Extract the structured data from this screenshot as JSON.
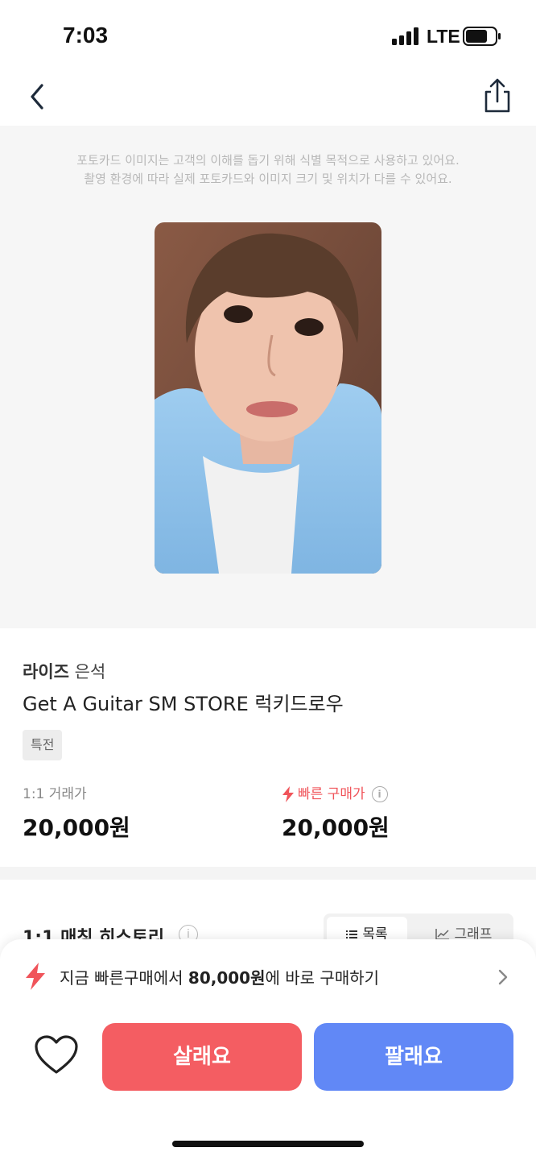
{
  "status_bar": {
    "time": "7:03",
    "network": "LTE"
  },
  "image_section": {
    "notice_line1": "포토카드 이미지는 고객의 이해를 돕기 위해 식별 목적으로 사용하고 있어요.",
    "notice_line2": "촬영 환경에 따라 실제 포토카드와 이미지 크기 및 위치가 다를 수 있어요."
  },
  "product": {
    "group": "라이즈",
    "member": "은석",
    "name": "Get A Guitar SM STORE 럭키드로우",
    "tag": "특전",
    "trade_price_label": "1:1 거래가",
    "trade_price": "20,000원",
    "fast_price_label": "빠른 구매가",
    "fast_price": "20,000원"
  },
  "history": {
    "title": "1:1 매칭 히스토리",
    "tabs": [
      {
        "label": "목록",
        "active": true
      },
      {
        "label": "그래프",
        "active": false
      }
    ]
  },
  "promo": {
    "prefix": "지금 빠른구매에서 ",
    "amount": "80,000원",
    "suffix": "에 바로 구매하기"
  },
  "actions": {
    "buy_label": "살래요",
    "sell_label": "팔래요"
  },
  "colors": {
    "buy": "#f45d62",
    "sell": "#6188f6",
    "fast_accent": "#f0545a"
  }
}
